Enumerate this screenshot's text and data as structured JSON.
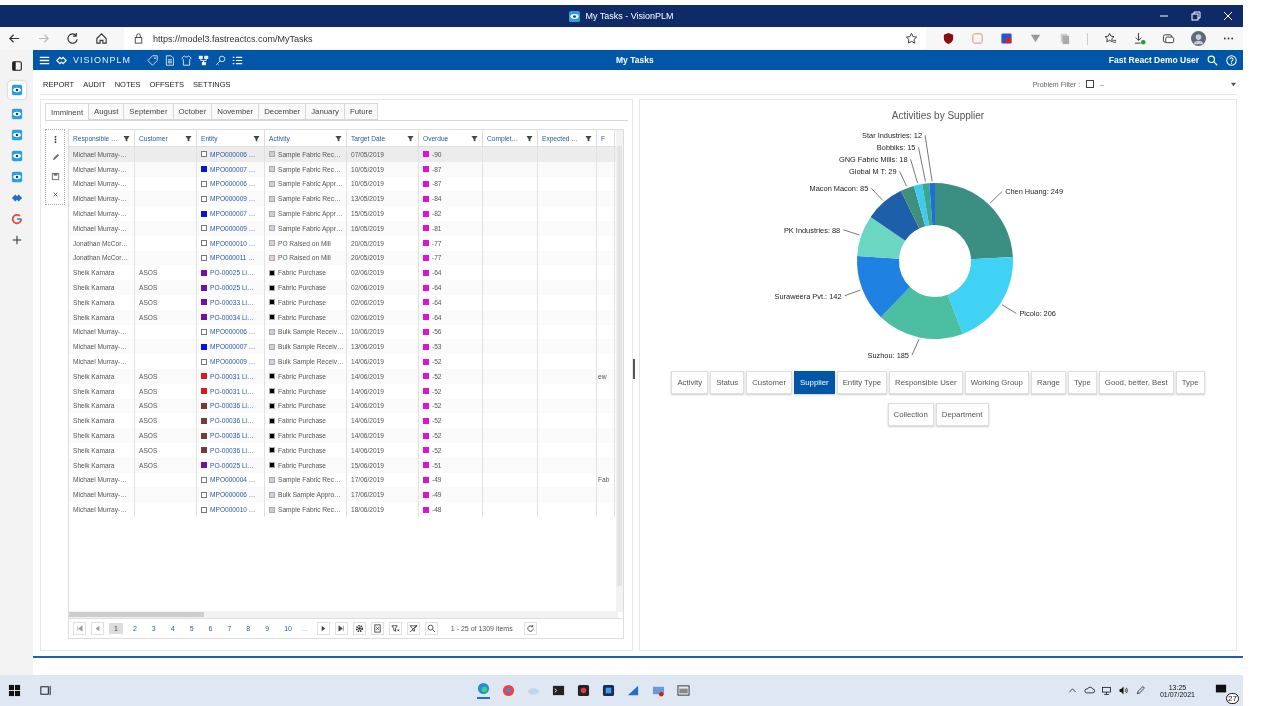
{
  "window": {
    "title": "My Tasks - VisionPLM"
  },
  "browser": {
    "url": "https://model3.fastreactcs.com/MyTasks"
  },
  "app_header": {
    "logo": "VISIONPLM",
    "title": "My Tasks",
    "user": "Fast React Demo User"
  },
  "menu": [
    "REPORT",
    "AUDIT",
    "NOTES",
    "OFFSETS",
    "SETTINGS"
  ],
  "problem_filter": {
    "label": "Problem Filter :",
    "checked": false,
    "value": "–"
  },
  "tabs": [
    {
      "label": "Imminent",
      "selected": true
    },
    {
      "label": "August",
      "selected": false
    },
    {
      "label": "September",
      "selected": false
    },
    {
      "label": "October",
      "selected": false
    },
    {
      "label": "November",
      "selected": false
    },
    {
      "label": "December",
      "selected": false
    },
    {
      "label": "January",
      "selected": false
    },
    {
      "label": "Future",
      "selected": false
    }
  ],
  "table": {
    "columns": [
      "Responsible …",
      "Customer",
      "Entity",
      "Activity",
      "Target Date",
      "Overdue",
      "Complet…",
      "Expected …",
      "F"
    ],
    "rows": [
      {
        "responsible": "Michael Murray-…",
        "entity": {
          "text": "MPO000006 …",
          "color": "#ffffff"
        },
        "activity": {
          "text": "Sample Fabric Rec…",
          "color": "#c9cedd"
        },
        "target_date": "07/05/2019",
        "overdue": "-90",
        "selected": true
      },
      {
        "responsible": "Michael Murray-…",
        "entity": {
          "text": "MPO000007 …",
          "color": "#0a10e8"
        },
        "activity": {
          "text": "Sample Fabric Rec…",
          "color": "#c9cedd"
        },
        "target_date": "10/05/2019",
        "overdue": "-87",
        "selected": false
      },
      {
        "responsible": "Michael Murray-…",
        "entity": {
          "text": "MPO000006 …",
          "color": "#ffffff"
        },
        "activity": {
          "text": "Sample Fabric Appr…",
          "color": "#c6d3e6"
        },
        "target_date": "10/05/2019",
        "overdue": "-87",
        "selected": false
      },
      {
        "responsible": "Michael Murray-…",
        "entity": {
          "text": "MPO000009 …",
          "color": "#ffffff"
        },
        "activity": {
          "text": "Sample Fabric Rec…",
          "color": "#c9cedd"
        },
        "target_date": "13/05/2019",
        "overdue": "-84",
        "selected": false
      },
      {
        "responsible": "Michael Murray-…",
        "entity": {
          "text": "MPO000007 …",
          "color": "#0a10e8"
        },
        "activity": {
          "text": "Sample Fabric Appr…",
          "color": "#c6d3e6"
        },
        "target_date": "15/05/2019",
        "overdue": "-82",
        "selected": false
      },
      {
        "responsible": "Michael Murray-…",
        "entity": {
          "text": "MPO000009 …",
          "color": "#ffffff"
        },
        "activity": {
          "text": "Sample Fabric Appr…",
          "color": "#c6d3e6"
        },
        "target_date": "16/05/2019",
        "overdue": "-81",
        "selected": false
      },
      {
        "responsible": "Jonathan McCor…",
        "entity": {
          "text": "MPO000010 …",
          "color": "#ffffff"
        },
        "activity": {
          "text": "PO Raised on Mill",
          "color": "#e6cdd2"
        },
        "target_date": "20/05/2019",
        "overdue": "-77",
        "selected": false
      },
      {
        "responsible": "Jonathan McCor…",
        "entity": {
          "text": "MPO000011 …",
          "color": "#ffffff"
        },
        "activity": {
          "text": "PO Raised on Mill",
          "color": "#e6cdd2"
        },
        "target_date": "20/05/2019",
        "overdue": "-77",
        "selected": false
      },
      {
        "responsible": "Sheik Kamara",
        "customer": "ASOS",
        "entity": {
          "text": "PO-00025 Li…",
          "color": "#7010a8"
        },
        "activity": {
          "text": "Fabric Purchase",
          "color": "#000000"
        },
        "target_date": "02/06/2019",
        "overdue": "-64",
        "selected": false
      },
      {
        "responsible": "Sheik Kamara",
        "customer": "ASOS",
        "entity": {
          "text": "PO-00025 Li…",
          "color": "#7010a8"
        },
        "activity": {
          "text": "Fabric Purchase",
          "color": "#000000"
        },
        "target_date": "02/06/2019",
        "overdue": "-64",
        "selected": false
      },
      {
        "responsible": "Sheik Kamara",
        "customer": "ASOS",
        "entity": {
          "text": "PO-00033 Li…",
          "color": "#7010a8"
        },
        "activity": {
          "text": "Fabric Purchase",
          "color": "#000000"
        },
        "target_date": "02/06/2019",
        "overdue": "-64",
        "selected": false
      },
      {
        "responsible": "Sheik Kamara",
        "customer": "ASOS",
        "entity": {
          "text": "PO-00034 Li…",
          "color": "#7010a8"
        },
        "activity": {
          "text": "Fabric Purchase",
          "color": "#000000"
        },
        "target_date": "02/06/2019",
        "overdue": "-64",
        "selected": false
      },
      {
        "responsible": "Michael Murray-…",
        "entity": {
          "text": "MPO000006 …",
          "color": "#ffffff"
        },
        "activity": {
          "text": "Bulk Sample Receiv…",
          "color": "#c6d3e6"
        },
        "target_date": "10/06/2019",
        "overdue": "-56",
        "selected": false
      },
      {
        "responsible": "Michael Murray-…",
        "entity": {
          "text": "MPO000007 …",
          "color": "#0a10e8"
        },
        "activity": {
          "text": "Bulk Sample Receiv…",
          "color": "#c6d3e6"
        },
        "target_date": "13/06/2019",
        "overdue": "-53",
        "selected": false
      },
      {
        "responsible": "Michael Murray-…",
        "entity": {
          "text": "MPO000009 …",
          "color": "#ffffff"
        },
        "activity": {
          "text": "Bulk Sample Receiv…",
          "color": "#c6d3e6"
        },
        "target_date": "14/06/2019",
        "overdue": "-52",
        "selected": false
      },
      {
        "responsible": "Sheik Kamara",
        "customer": "ASOS",
        "entity": {
          "text": "PO-00031 Li…",
          "color": "#e01818"
        },
        "activity": {
          "text": "Fabric Purchase",
          "color": "#000000"
        },
        "target_date": "14/06/2019",
        "overdue": "-52",
        "column_9": "ew",
        "selected": false
      },
      {
        "responsible": "Sheik Kamara",
        "customer": "ASOS",
        "entity": {
          "text": "PO-00031 Li…",
          "color": "#e01818"
        },
        "activity": {
          "text": "Fabric Purchase",
          "color": "#000000"
        },
        "target_date": "14/06/2019",
        "overdue": "-52",
        "selected": false
      },
      {
        "responsible": "Sheik Kamara",
        "customer": "ASOS",
        "entity": {
          "text": "PO-00036 Li…",
          "color": "#7a3838"
        },
        "activity": {
          "text": "Fabric Purchase",
          "color": "#000000"
        },
        "target_date": "14/06/2019",
        "overdue": "-52",
        "selected": false
      },
      {
        "responsible": "Sheik Kamara",
        "customer": "ASOS",
        "entity": {
          "text": "PO-00036 Li…",
          "color": "#7a3838"
        },
        "activity": {
          "text": "Fabric Purchase",
          "color": "#000000"
        },
        "target_date": "14/06/2019",
        "overdue": "-52",
        "selected": false
      },
      {
        "responsible": "Sheik Kamara",
        "customer": "ASOS",
        "entity": {
          "text": "PO-00036 Li…",
          "color": "#7a3838"
        },
        "activity": {
          "text": "Fabric Purchase",
          "color": "#000000"
        },
        "target_date": "14/06/2019",
        "overdue": "-52",
        "selected": false
      },
      {
        "responsible": "Sheik Kamara",
        "customer": "ASOS",
        "entity": {
          "text": "PO-00036 Li…",
          "color": "#7a3838"
        },
        "activity": {
          "text": "Fabric Purchase",
          "color": "#000000"
        },
        "target_date": "14/06/2019",
        "overdue": "-52",
        "selected": false
      },
      {
        "responsible": "Sheik Kamara",
        "customer": "ASOS",
        "entity": {
          "text": "PO-00025 Li…",
          "color": "#7010a8"
        },
        "activity": {
          "text": "Fabric Purchase",
          "color": "#000000"
        },
        "target_date": "15/06/2019",
        "overdue": "-51",
        "selected": false
      },
      {
        "responsible": "Michael Murray-…",
        "entity": {
          "text": "MPO000004 …",
          "color": "#ffffff"
        },
        "activity": {
          "text": "Sample Fabric Rec…",
          "color": "#c9cedd"
        },
        "target_date": "17/06/2019",
        "overdue": "-49",
        "column_9": "Fab",
        "selected": false
      },
      {
        "responsible": "Michael Murray-…",
        "entity": {
          "text": "MPO000006 …",
          "color": "#ffffff"
        },
        "activity": {
          "text": "Bulk Sample Appro…",
          "color": "#c6d3e6"
        },
        "target_date": "17/06/2019",
        "overdue": "-49",
        "selected": false
      },
      {
        "responsible": "Michael Murray-…",
        "entity": {
          "text": "MPO000010 …",
          "color": "#ffffff"
        },
        "activity": {
          "text": "Sample Fabric Rec…",
          "color": "#c9cedd"
        },
        "target_date": "18/06/2019",
        "overdue": "-48",
        "selected": false
      }
    ]
  },
  "pager": {
    "pages": [
      {
        "label": "1",
        "selected": true
      },
      {
        "label": "2",
        "selected": false
      },
      {
        "label": "3",
        "selected": false
      },
      {
        "label": "4",
        "selected": false
      },
      {
        "label": "5",
        "selected": false
      },
      {
        "label": "6",
        "selected": false
      },
      {
        "label": "7",
        "selected": false
      },
      {
        "label": "8",
        "selected": false
      },
      {
        "label": "9",
        "selected": false
      },
      {
        "label": "10",
        "selected": false
      }
    ],
    "more": "...",
    "summary": "1 - 25 of 1309 items"
  },
  "chart": {
    "chart_data": {
      "type": "donut",
      "title": "Activities by Supplier",
      "values": [
        249,
        206,
        185,
        142,
        88,
        85,
        29,
        18,
        15,
        12
      ],
      "value_labels": [
        "Chen Huang: 249",
        "Picolo: 206",
        "Suzhou: 185",
        "Suraweera Pvt.: 142",
        "PK Industries: 88",
        "Macon Macon: 85",
        "Global M T: 29",
        "GNG Fabric Mills: 18",
        "Bobbiks: 15",
        "Star Industries: 12"
      ],
      "colors": [
        "#3a8f82",
        "#3fd2f5",
        "#4cbfa2",
        "#1f82e2",
        "#6bd6c2",
        "#1d5fa8",
        "#3f8f7c",
        "#42c9f0",
        "#38a88f",
        "#1e6fd8"
      ]
    }
  },
  "chart_buttons": [
    {
      "label": "Activity",
      "selected": false
    },
    {
      "label": "Status",
      "selected": false
    },
    {
      "label": "Customer",
      "selected": false
    },
    {
      "label": "Supplier",
      "selected": true
    },
    {
      "label": "Entity Type",
      "selected": false
    },
    {
      "label": "Responsible User",
      "selected": false
    },
    {
      "label": "Working Group",
      "selected": false
    },
    {
      "label": "Range",
      "selected": false
    },
    {
      "label": "Type",
      "selected": false
    },
    {
      "label": "Good, better, Best",
      "selected": false
    },
    {
      "label": "Type",
      "selected": false
    },
    {
      "label": "Collection",
      "selected": false
    },
    {
      "label": "Department",
      "selected": false
    }
  ],
  "taskbar": {
    "time": "13:25",
    "date": "01/07/2021",
    "notifications": "27"
  }
}
